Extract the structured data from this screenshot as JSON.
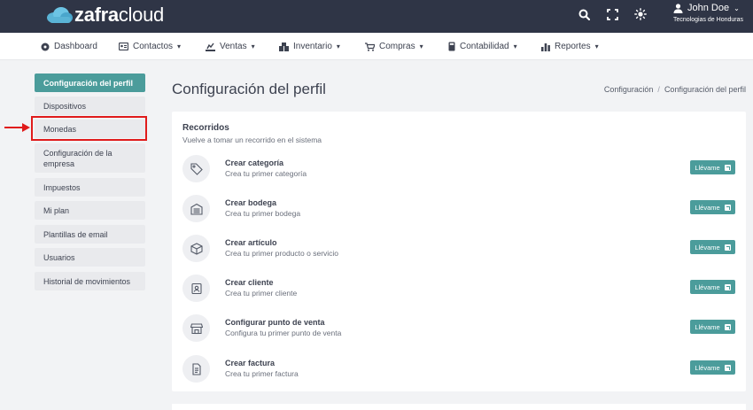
{
  "brand": {
    "logo_bold": "zafra",
    "logo_light": "cloud"
  },
  "header": {
    "icons": [
      "search-icon",
      "fullscreen-icon",
      "sun-icon"
    ],
    "user_name": "John Doe",
    "organization": "Tecnologias de Honduras"
  },
  "nav": {
    "items": [
      {
        "label": "Dashboard",
        "icon": "dashboard-icon",
        "has_caret": false
      },
      {
        "label": "Contactos",
        "icon": "contacts-icon",
        "has_caret": true
      },
      {
        "label": "Ventas",
        "icon": "sales-icon",
        "has_caret": true
      },
      {
        "label": "Inventario",
        "icon": "inventory-icon",
        "has_caret": true
      },
      {
        "label": "Compras",
        "icon": "cart-icon",
        "has_caret": true
      },
      {
        "label": "Contabilidad",
        "icon": "calculator-icon",
        "has_caret": true
      },
      {
        "label": "Reportes",
        "icon": "bar-chart-icon",
        "has_caret": true
      }
    ]
  },
  "sidebar": {
    "items": [
      {
        "label": "Configuración del perfil",
        "active": true
      },
      {
        "label": "Dispositivos"
      },
      {
        "label": "Monedas",
        "highlighted": true
      },
      {
        "label": "Configuración de la empresa"
      },
      {
        "label": "Impuestos"
      },
      {
        "label": "Mi plan"
      },
      {
        "label": "Plantillas de email"
      },
      {
        "label": "Usuarios"
      },
      {
        "label": "Historial de movimientos"
      }
    ]
  },
  "page": {
    "title": "Configuración del perfil",
    "breadcrumb": [
      "Configuración",
      "/",
      "Configuración del perfil"
    ]
  },
  "tours": {
    "title": "Recorridos",
    "subtitle": "Vuelve a tomar un recorrido en el sistema",
    "button_label": "Llévame",
    "items": [
      {
        "title": "Crear categoría",
        "description": "Crea tu primer categoría",
        "icon": "tag-icon"
      },
      {
        "title": "Crear bodega",
        "description": "Crea tu primer bodega",
        "icon": "warehouse-icon"
      },
      {
        "title": "Crear artículo",
        "description": "Crea tu primer producto o servicio",
        "icon": "box-icon"
      },
      {
        "title": "Crear cliente",
        "description": "Crea tu primer cliente",
        "icon": "contact-card-icon"
      },
      {
        "title": "Configurar punto de venta",
        "description": "Configura tu primer punto de venta",
        "icon": "store-icon"
      },
      {
        "title": "Crear factura",
        "description": "Crea tu primer factura",
        "icon": "invoice-icon"
      }
    ]
  },
  "colors": {
    "header_bg": "#2f3546",
    "accent": "#4b9c9b",
    "highlight": "#e01b1b"
  }
}
